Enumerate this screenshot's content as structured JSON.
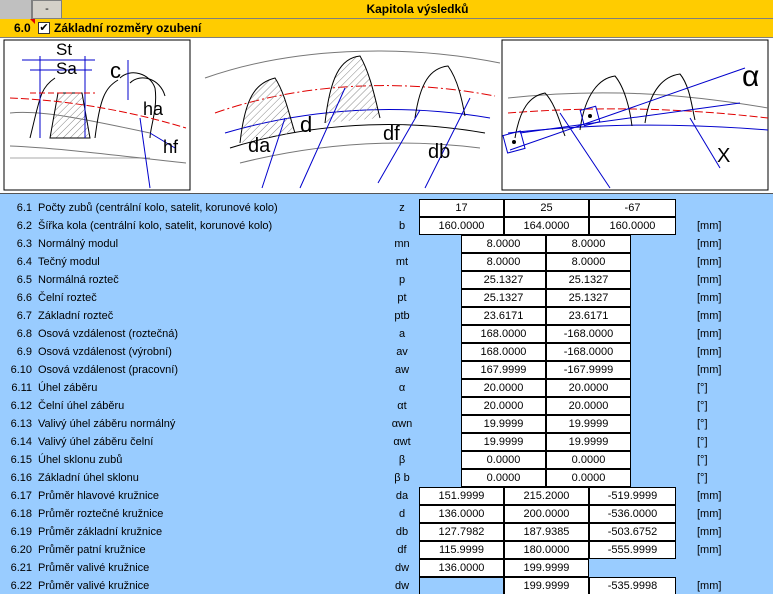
{
  "header": {
    "collapse_label": "-",
    "title": "Kapitola výsledků"
  },
  "section": {
    "number": "6.0",
    "checkbox_glyph": "✔",
    "label": "Základní rozměry ozubení"
  },
  "figure": {
    "labels": {
      "st": "St",
      "sa": "Sa",
      "c": "c",
      "ha": "ha",
      "hf": "hf",
      "da": "da",
      "d": "d",
      "df": "df",
      "db": "db",
      "alpha": "α",
      "x": "X"
    }
  },
  "rows": [
    {
      "no": "6.1",
      "name": "Počty zubů (centrální kolo, satelit, korunové kolo)",
      "sym": "z",
      "layout": "three",
      "values": [
        "17",
        "25",
        "-67"
      ],
      "unit": ""
    },
    {
      "no": "6.2",
      "name": "Šířka kola  (centrální kolo, satelit, korunové kolo)",
      "sym": "b",
      "layout": "three",
      "values": [
        "160.0000",
        "164.0000",
        "160.0000"
      ],
      "unit": "[mm]"
    },
    {
      "no": "6.3",
      "name": "Normálný modul",
      "sym": "mn",
      "layout": "two",
      "values": [
        "8.0000",
        "8.0000"
      ],
      "unit": "[mm]"
    },
    {
      "no": "6.4",
      "name": "Tečný modul",
      "sym": "mt",
      "layout": "two",
      "values": [
        "8.0000",
        "8.0000"
      ],
      "unit": "[mm]"
    },
    {
      "no": "6.5",
      "name": "Normálná rozteč",
      "sym": "p",
      "layout": "two",
      "values": [
        "25.1327",
        "25.1327"
      ],
      "unit": "[mm]"
    },
    {
      "no": "6.6",
      "name": "Čelní rozteč",
      "sym": "pt",
      "layout": "two",
      "values": [
        "25.1327",
        "25.1327"
      ],
      "unit": "[mm]"
    },
    {
      "no": "6.7",
      "name": "Základní rozteč",
      "sym": "ptb",
      "layout": "two",
      "values": [
        "23.6171",
        "23.6171"
      ],
      "unit": "[mm]"
    },
    {
      "no": "6.8",
      "name": "Osová vzdálenost (roztečná)",
      "sym": "a",
      "layout": "two",
      "values": [
        "168.0000",
        "-168.0000"
      ],
      "unit": "[mm]"
    },
    {
      "no": "6.9",
      "name": "Osová vzdálenost (výrobní)",
      "sym": "av",
      "layout": "two",
      "values": [
        "168.0000",
        "-168.0000"
      ],
      "unit": "[mm]"
    },
    {
      "no": "6.10",
      "name": "Osová vzdálenost (pracovní)",
      "sym": "aw",
      "layout": "two",
      "values": [
        "167.9999",
        "-167.9999"
      ],
      "unit": "[mm]"
    },
    {
      "no": "6.11",
      "name": "Úhel záběru",
      "sym": "α",
      "layout": "two",
      "values": [
        "20.0000",
        "20.0000"
      ],
      "unit": "[°]"
    },
    {
      "no": "6.12",
      "name": "Čelní úhel záběru",
      "sym": "αt",
      "layout": "two",
      "values": [
        "20.0000",
        "20.0000"
      ],
      "unit": "[°]"
    },
    {
      "no": "6.13",
      "name": "Valivý úhel záběru normálný",
      "sym": "αwn",
      "layout": "two",
      "values": [
        "19.9999",
        "19.9999"
      ],
      "unit": "[°]"
    },
    {
      "no": "6.14",
      "name": "Valivý úhel záběru čelní",
      "sym": "αwt",
      "layout": "two",
      "values": [
        "19.9999",
        "19.9999"
      ],
      "unit": "[°]"
    },
    {
      "no": "6.15",
      "name": "Úhel sklonu zubů",
      "sym": "β",
      "layout": "two",
      "values": [
        "0.0000",
        "0.0000"
      ],
      "unit": "[°]"
    },
    {
      "no": "6.16",
      "name": "Základní úhel sklonu",
      "sym": "β b",
      "layout": "two",
      "values": [
        "0.0000",
        "0.0000"
      ],
      "unit": "[°]"
    },
    {
      "no": "6.17",
      "name": "Průměr hlavové kružnice",
      "sym": "da",
      "layout": "three",
      "values": [
        "151.9999",
        "215.2000",
        "-519.9999"
      ],
      "unit": "[mm]"
    },
    {
      "no": "6.18",
      "name": "Průměr roztečné kružnice",
      "sym": "d",
      "layout": "three",
      "values": [
        "136.0000",
        "200.0000",
        "-536.0000"
      ],
      "unit": "[mm]"
    },
    {
      "no": "6.19",
      "name": "Průměr základní kružnice",
      "sym": "db",
      "layout": "three",
      "values": [
        "127.7982",
        "187.9385",
        "-503.6752"
      ],
      "unit": "[mm]"
    },
    {
      "no": "6.20",
      "name": "Průměr patní kružnice",
      "sym": "df",
      "layout": "three",
      "values": [
        "115.9999",
        "180.0000",
        "-555.9999"
      ],
      "unit": "[mm]"
    },
    {
      "no": "6.21",
      "name": "Průměr valivé kružnice",
      "sym": "dw",
      "layout": "two-first",
      "values": [
        "136.0000",
        "199.9999"
      ],
      "unit": ""
    },
    {
      "no": "6.22",
      "name": "Průměr valivé kružnice",
      "sym": "dw",
      "layout": "two-last",
      "values": [
        "199.9999",
        "-535.9998"
      ],
      "unit": "[mm]"
    }
  ]
}
